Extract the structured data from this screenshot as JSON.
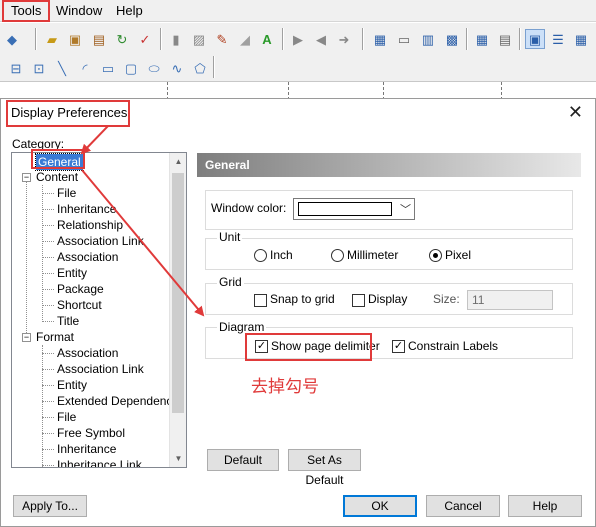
{
  "menubar": {
    "items": [
      "Tools",
      "Window",
      "Help"
    ]
  },
  "toolbar1": {
    "icons": [
      "model-icon",
      "open-icon",
      "package-icon",
      "refresh-icon",
      "check-icon",
      "shape-icon",
      "fill-icon",
      "pen-icon",
      "font-icon",
      "shape2-icon",
      "arrow-left-icon",
      "arrow-right-icon",
      "window-icon",
      "window2-icon",
      "window3-icon",
      "window4-icon",
      "window5-icon",
      "window6-icon",
      "grid-icon",
      "select-icon",
      "list-icon",
      "table-icon"
    ]
  },
  "toolbar2": {
    "icons": [
      "db-icon",
      "text-icon",
      "line-icon",
      "arc-icon",
      "rect-icon",
      "rounded-rect-icon",
      "ellipse-icon",
      "polyline-icon",
      "polygon-icon"
    ]
  },
  "dialog": {
    "title": "Display Preferences",
    "category_label": "Category:",
    "tree": {
      "general": "General",
      "content": {
        "label": "Content",
        "items": [
          "File",
          "Inheritance",
          "Relationship",
          "Association Link",
          "Association",
          "Entity",
          "Package",
          "Shortcut",
          "Title"
        ]
      },
      "format": {
        "label": "Format",
        "items": [
          "Association",
          "Association Link",
          "Entity",
          "Extended Dependency",
          "File",
          "Free Symbol",
          "Inheritance",
          "Inheritance Link"
        ]
      }
    },
    "panel": {
      "header": "General",
      "window_color_label": "Window color:",
      "window_color": "#ffffff",
      "unit": {
        "label": "Unit",
        "options": [
          "Inch",
          "Millimeter",
          "Pixel"
        ],
        "selected": "Pixel"
      },
      "grid": {
        "label": "Grid",
        "snap_label": "Snap to grid",
        "snap_checked": false,
        "display_label": "Display",
        "display_checked": false,
        "size_label": "Size:",
        "size_value": "11"
      },
      "diagram": {
        "label": "Diagram",
        "show_page_delimiter_label": "Show page delimiter",
        "show_page_delimiter_checked": true,
        "constrain_labels_label": "Constrain Labels",
        "constrain_labels_checked": true
      },
      "annotation": "去掉勾号",
      "default_button": "Default",
      "set_default_button": "Set As Default"
    },
    "buttons": {
      "apply_to": "Apply To...",
      "ok": "OK",
      "cancel": "Cancel",
      "help": "Help"
    }
  },
  "colors": {
    "highlight": "#e03a3a",
    "selection": "#3a7bd5"
  }
}
